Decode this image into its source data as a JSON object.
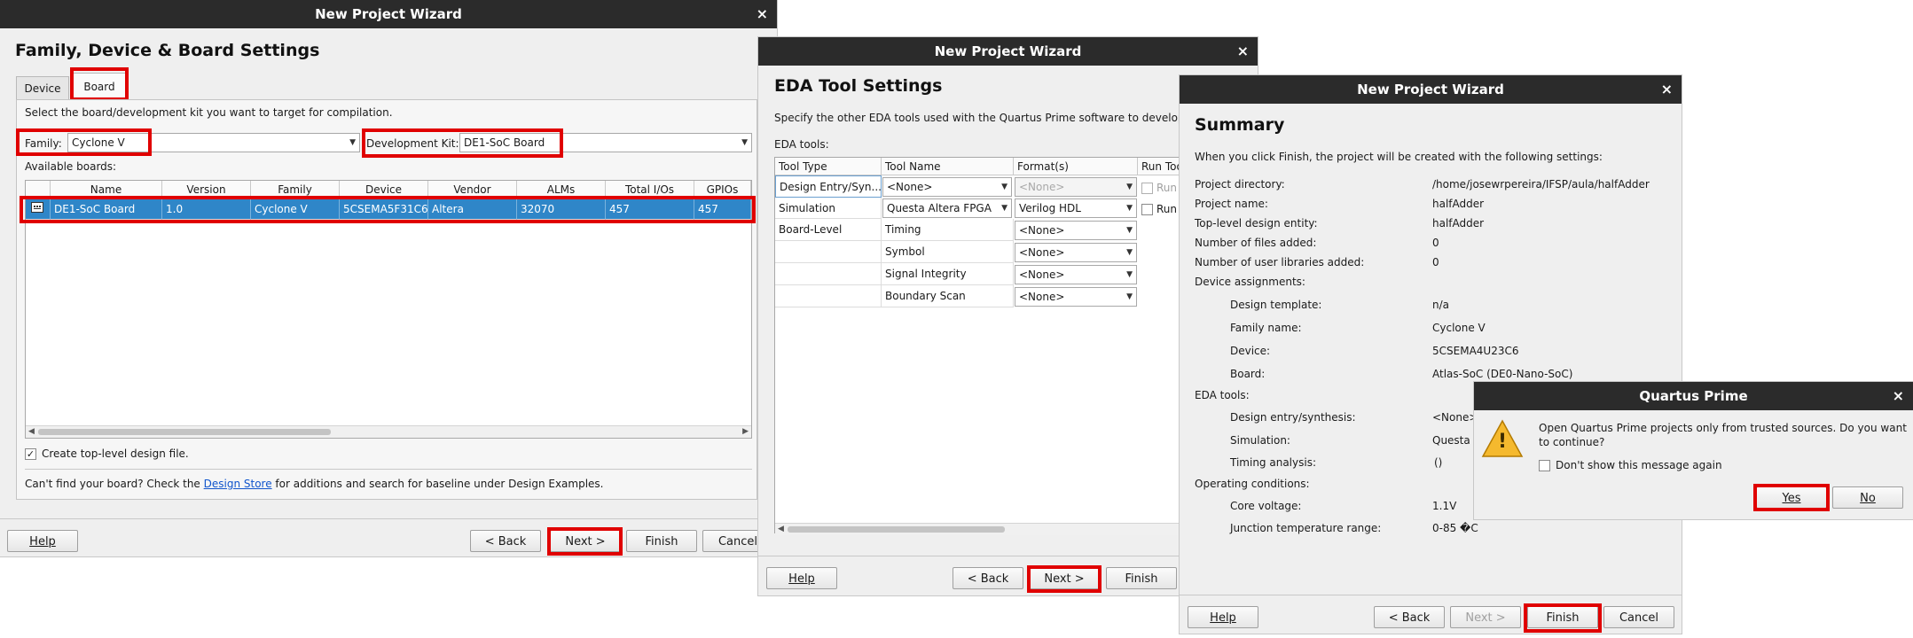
{
  "wizard1": {
    "title": "New Project Wizard",
    "close_glyph": "×",
    "heading": "Family, Device & Board Settings",
    "tabs": [
      "Device",
      "Board"
    ],
    "description": "Select the board/development kit you want to target for compilation.",
    "family_label": "Family:",
    "family_value": "Cyclone V",
    "devkit_label": "Development Kit:",
    "devkit_value": "DE1-SoC Board",
    "available_label": "Available boards:",
    "columns": [
      "Name",
      "Version",
      "Family",
      "Device",
      "Vendor",
      "ALMs",
      "Total I/Os",
      "GPIOs"
    ],
    "row": [
      "DE1-SoC Board",
      "1.0",
      "Cyclone V",
      "5CSEMA5F31C6",
      "Altera",
      "32070",
      "457",
      "457"
    ],
    "create_toplevel": "Create top-level design file.",
    "cant_find_pre": "Can't find your board? Check the ",
    "cant_find_link": "Design Store",
    "cant_find_post": " for additions and search for baseline under Design Examples.",
    "buttons": {
      "help": "Help",
      "back": "< Back",
      "next": "Next >",
      "finish": "Finish",
      "cancel": "Cancel"
    }
  },
  "wizard2": {
    "title": "New Project Wizard",
    "close_glyph": "×",
    "heading": "EDA Tool Settings",
    "description": "Specify the other EDA tools used with the Quartus Prime software to develop your project.",
    "eda_tools_label": "EDA tools:",
    "columns": [
      "Tool Type",
      "Tool Name",
      "Format(s)",
      "Run Tool"
    ],
    "rows": [
      {
        "type": "Design Entry/Syn...",
        "name": "<None>",
        "format": "<None>",
        "run": "Run"
      },
      {
        "type": "Simulation",
        "name": "Questa Altera FPGA",
        "format": "Verilog HDL",
        "run": "Run"
      },
      {
        "type": "Board-Level",
        "name": "Timing",
        "format": "<None>"
      },
      {
        "type": "",
        "name": "Symbol",
        "format": "<None>"
      },
      {
        "type": "",
        "name": "Signal Integrity",
        "format": "<None>"
      },
      {
        "type": "",
        "name": "Boundary Scan",
        "format": "<None>"
      }
    ],
    "buttons": {
      "help": "Help",
      "back": "< Back",
      "next": "Next >",
      "finish": "Finish"
    }
  },
  "wizard3": {
    "title": "New Project Wizard",
    "close_glyph": "×",
    "heading": "Summary",
    "description": "When you click Finish, the project will be created with the following settings:",
    "rows": [
      {
        "label": "Project directory:",
        "value": "/home/josewrpereira/IFSP/aula/halfAdder"
      },
      {
        "label": "Project name:",
        "value": "halfAdder"
      },
      {
        "label": "Top-level design entity:",
        "value": "halfAdder"
      },
      {
        "label": "Number of files added:",
        "value": "0"
      },
      {
        "label": "Number of user libraries added:",
        "value": "0"
      },
      {
        "label": "Device assignments:",
        "value": ""
      },
      {
        "label": "Design template:",
        "value": "n/a"
      },
      {
        "label": "Family name:",
        "value": "Cyclone V"
      },
      {
        "label": "Device:",
        "value": "5CSEMA4U23C6"
      },
      {
        "label": "Board:",
        "value": "Atlas-SoC (DE0-Nano-SoC)"
      },
      {
        "label": "EDA tools:",
        "value": ""
      },
      {
        "label": "Design entry/synthesis:",
        "value": "<None>"
      },
      {
        "label": "Simulation:",
        "value": "Questa"
      },
      {
        "label": "Timing analysis:",
        "value": "()"
      },
      {
        "label": "Operating conditions:",
        "value": ""
      },
      {
        "label": "Core voltage:",
        "value": "1.1V"
      },
      {
        "label": "Junction temperature range:",
        "value": "0-85 �C"
      }
    ],
    "buttons": {
      "help": "Help",
      "back": "< Back",
      "next": "Next >",
      "finish": "Finish",
      "cancel": "Cancel"
    }
  },
  "dialog": {
    "title": "Quartus Prime",
    "close_glyph": "×",
    "message_line1": "Open Quartus Prime projects only from trusted sources. Do you want",
    "message_line2": "to continue?",
    "dont_show": "Don't show this message again",
    "warning_glyph": "!",
    "yes": "Yes",
    "no": "No"
  },
  "colors": {
    "titlebar": "#2b2b2b",
    "highlight": "#e00000",
    "selection": "#2f86c8",
    "link": "#1155cc"
  },
  "icons": [
    "close-icon",
    "dropdown-arrow-icon",
    "board-icon",
    "warning-icon",
    "checkbox-icon"
  ]
}
